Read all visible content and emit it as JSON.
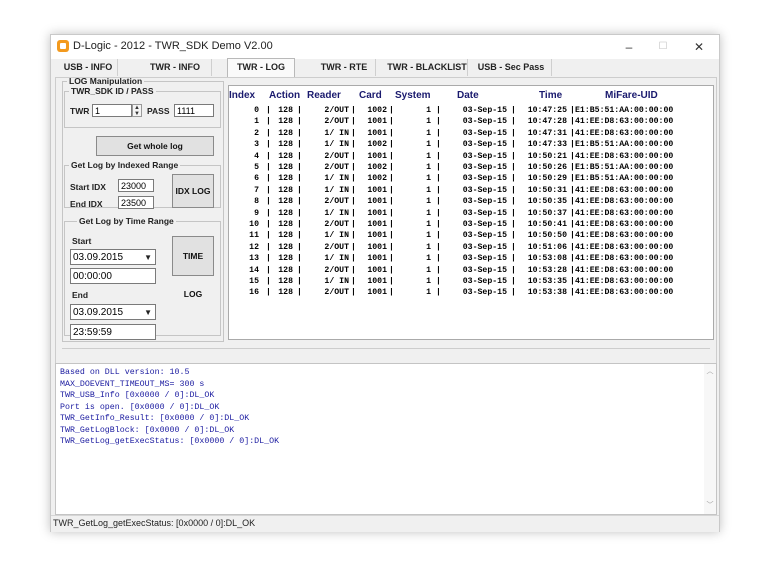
{
  "window": {
    "title": "D-Logic - 2012 - TWR_SDK Demo V2.00",
    "minimize": "–",
    "maximize": "☐",
    "close": "✕"
  },
  "tabs": [
    {
      "label": "USB - INFO"
    },
    {
      "label": "TWR - INFO"
    },
    {
      "label": "TWR - LOG",
      "active": true
    },
    {
      "label": "TWR - RTE"
    },
    {
      "label": "TWR - BLACKLIST"
    },
    {
      "label": "USB - Sec Pass"
    }
  ],
  "log_manipulation": {
    "legend": "LOG Manipulation",
    "id_pass": {
      "legend": "TWR_SDK ID / PASS",
      "twr_label": "TWR",
      "twr_value": "1",
      "pass_label": "PASS",
      "pass_value": "1111"
    },
    "get_whole_log": "Get whole log",
    "indexed": {
      "legend": "Get Log by Indexed Range",
      "start_label": "Start IDX",
      "start_value": "23000",
      "end_label": "End IDX",
      "end_value": "23500",
      "button": "IDX LOG"
    },
    "time": {
      "legend": "Get Log by Time Range",
      "start_label": "Start",
      "start_date": "03.09.2015",
      "start_time": "00:00:00",
      "end_label": "End",
      "end_date": "03.09.2015",
      "end_time": "23:59:59",
      "button": "TIME LOG"
    }
  },
  "log_table": {
    "columns": [
      "Index",
      "Action",
      "Reader",
      "Card",
      "System",
      "Date",
      "Time",
      "MiFare-UID"
    ],
    "rows": [
      [
        "0",
        "128",
        "2/OUT",
        "1002",
        "1",
        "03-Sep-15",
        "10:47:25",
        "E1:B5:51:AA:00:00:00"
      ],
      [
        "1",
        "128",
        "2/OUT",
        "1001",
        "1",
        "03-Sep-15",
        "10:47:28",
        "41:EE:D8:63:00:00:00"
      ],
      [
        "2",
        "128",
        "1/ IN",
        "1001",
        "1",
        "03-Sep-15",
        "10:47:31",
        "41:EE:D8:63:00:00:00"
      ],
      [
        "3",
        "128",
        "1/ IN",
        "1002",
        "1",
        "03-Sep-15",
        "10:47:33",
        "E1:B5:51:AA:00:00:00"
      ],
      [
        "4",
        "128",
        "2/OUT",
        "1001",
        "1",
        "03-Sep-15",
        "10:50:21",
        "41:EE:D8:63:00:00:00"
      ],
      [
        "5",
        "128",
        "2/OUT",
        "1002",
        "1",
        "03-Sep-15",
        "10:50:26",
        "E1:B5:51:AA:00:00:00"
      ],
      [
        "6",
        "128",
        "1/ IN",
        "1002",
        "1",
        "03-Sep-15",
        "10:50:29",
        "E1:B5:51:AA:00:00:00"
      ],
      [
        "7",
        "128",
        "1/ IN",
        "1001",
        "1",
        "03-Sep-15",
        "10:50:31",
        "41:EE:D8:63:00:00:00"
      ],
      [
        "8",
        "128",
        "2/OUT",
        "1001",
        "1",
        "03-Sep-15",
        "10:50:35",
        "41:EE:D8:63:00:00:00"
      ],
      [
        "9",
        "128",
        "1/ IN",
        "1001",
        "1",
        "03-Sep-15",
        "10:50:37",
        "41:EE:D8:63:00:00:00"
      ],
      [
        "10",
        "128",
        "2/OUT",
        "1001",
        "1",
        "03-Sep-15",
        "10:50:41",
        "41:EE:D8:63:00:00:00"
      ],
      [
        "11",
        "128",
        "1/ IN",
        "1001",
        "1",
        "03-Sep-15",
        "10:50:50",
        "41:EE:D8:63:00:00:00"
      ],
      [
        "12",
        "128",
        "2/OUT",
        "1001",
        "1",
        "03-Sep-15",
        "10:51:06",
        "41:EE:D8:63:00:00:00"
      ],
      [
        "13",
        "128",
        "1/ IN",
        "1001",
        "1",
        "03-Sep-15",
        "10:53:08",
        "41:EE:D8:63:00:00:00"
      ],
      [
        "14",
        "128",
        "2/OUT",
        "1001",
        "1",
        "03-Sep-15",
        "10:53:28",
        "41:EE:D8:63:00:00:00"
      ],
      [
        "15",
        "128",
        "1/ IN",
        "1001",
        "1",
        "03-Sep-15",
        "10:53:35",
        "41:EE:D8:63:00:00:00"
      ],
      [
        "16",
        "128",
        "2/OUT",
        "1001",
        "1",
        "03-Sep-15",
        "10:53:38",
        "41:EE:D8:63:00:00:00"
      ]
    ]
  },
  "console": {
    "lines": [
      "Based on DLL version: 10.5",
      "MAX_DOEVENT_TIMEOUT_MS= 300 s",
      "TWR_USB_Info [0x0000 / 0]:DL_OK",
      "Port is open. [0x0000 / 0]:DL_OK",
      "TWR_GetInfo_Result: [0x0000 / 0]:DL_OK",
      "TWR_GetLogBlock: [0x0000 / 0]:DL_OK",
      "TWR_GetLog_getExecStatus: [0x0000 / 0]:DL_OK"
    ]
  },
  "status_bar": {
    "text": "TWR_GetLog_getExecStatus: [0x0000 / 0]:DL_OK"
  },
  "colors": {
    "header_text": "#1a1a6e",
    "console_text": "#1a1aa0",
    "app_icon": "#f39a1e"
  }
}
